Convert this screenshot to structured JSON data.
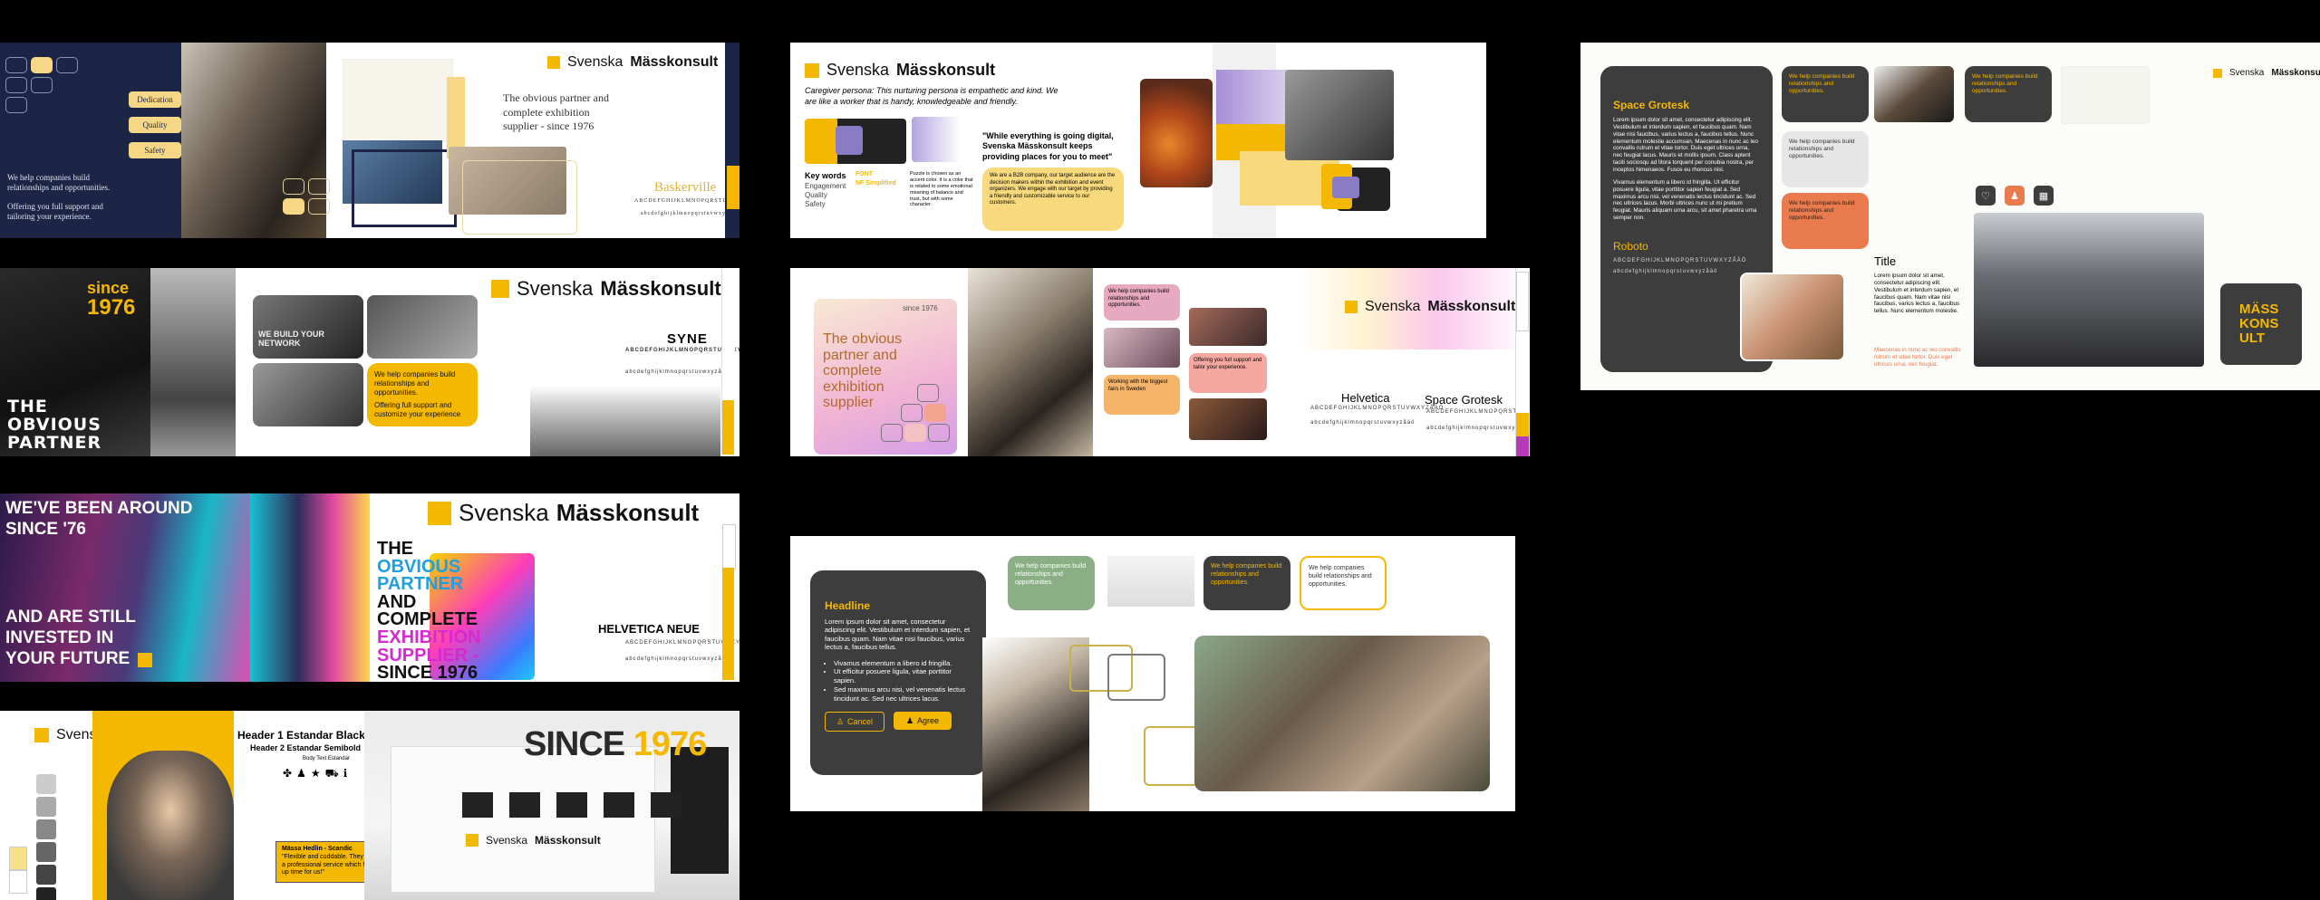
{
  "brand": {
    "name_light": "Svenska",
    "name_bold": "Mässkonsult",
    "accent": "#f5b800"
  },
  "board1": {
    "buttons": [
      "Dedication",
      "Quality",
      "Safety"
    ],
    "blurb": "We help companies build relationships and opportunities.",
    "blurb2": "Offering you full support and tailoring your experience.",
    "tagline": "The obvious partner and complete exhibition supplier - since 1976",
    "font_name": "Baskerville",
    "font_alpha": "ABCDEFGHIJKLMNOPQRSTUVWXYZÅÄÖ",
    "font_alpha_lower": "abcdefghijklmnopqrstuvwxyzåäö"
  },
  "board2": {
    "since": "since",
    "year": "1976",
    "headline": "THE OBVIOUS PARTNER",
    "photo_caption": "WE BUILD YOUR NETWORK",
    "card_text": "We help companies build relationships and opportunities.",
    "card_text2": "Offering full support and customize your experience",
    "font_name": "SYNE",
    "font_alpha": "ABCDEFGHIJKLMNOPQRSTUVWXYZÅÄÖ",
    "font_alpha_lower": "abcdefghijklmnopqrstuvwxyzåäö"
  },
  "board3": {
    "headline1": "WE'VE BEEN AROUND SINCE '76",
    "headline2": "AND ARE STILL INVESTED IN YOUR FUTURE",
    "tag_lines": [
      "THE",
      "OBVIOUS",
      "PARTNER",
      "AND",
      "COMPLETE",
      "EXHIBITION",
      "SUPPLIER -",
      "SINCE 1976"
    ],
    "font_name": "HELVETICA NEUE",
    "font_alpha": "ABCDEFGHIJKLMNOPQRSTUVWXYZÅÄÖ",
    "font_alpha_lower": "abcdefghijklmnopqrstuvwxyzåäö"
  },
  "board4": {
    "header1": "Header 1 Estandar Black",
    "header2": "Header 2 Estandar Semibold",
    "body": "Body Text Estandar",
    "quote_name": "Mässa Hedlin - Scandic",
    "quote": "\"Flexible and cuddable. They have a professional service which frees up time for us!\"",
    "since": "SINCE",
    "year": "1976"
  },
  "board5": {
    "persona": "Caregiver persona: This nurturing persona is empathetic and kind. We are like a worker that is handy, knowledgeable and friendly.",
    "quote": "\"While everything is going digital, Svenska Mässkonsult keeps providing places for you to meet\"",
    "keywords_title": "Key words",
    "keywords": [
      "Engagement",
      "Quality",
      "Safety"
    ],
    "font_label": "FONT",
    "font_value": "NF Simplified",
    "puzzle_text": "Puzzle is chosen as an accent color. It is a color that is related to some emotional meaning of balance and trust, but with some character.",
    "card_text": "We are a B2B company, our target audience are the decision makers within the exhibition and event organizers. We engage with our target by providing a friendly and customizable service to our customers."
  },
  "board6": {
    "since": "since 1976",
    "headline": "The obvious partner and complete exhibition supplier",
    "card1": "We help companies build relationships and opportunities.",
    "card2": "Offering you full support and tailor your experience.",
    "card3": "Working with the biggest fairs in Sweden",
    "font1_name": "Helvetica",
    "font2_name": "Space Grotesk",
    "font_alpha": "ABCDEFGHIJKLMNOPQRSTUVWXYZÅÄÖ",
    "font_alpha_lower": "abcdefghijklmnopqrstuvwxyzåäö"
  },
  "board7": {
    "headline": "Headline",
    "body": "Lorem ipsum dolor sit amet, consectetur adipiscing elit. Vestibulum et interdum sapien, et faucibus quam. Nam vitae nisi faucibus, varius lectus a, faucibus tellus.",
    "bullets": [
      "Vivamus elementum a libero id fringilla.",
      "Ut efficitur posuere ligula, vitae porttitor sapien.",
      "Sed maximus arcu nisi, vel venenatis lectus tincidunt ac. Sed nec ultrices lacus."
    ],
    "cancel": "Cancel",
    "agree": "Agree",
    "card_text": "We help companies build relationships and opportunities."
  },
  "board8": {
    "font1_name": "Space Grotesk",
    "font1_body": "Lorem ipsum dolor sit amet, consectetur adipiscing elit. Vestibulum et interdum sapien, et faucibus quam. Nam vitae nisi faucibus, varius lectus a, faucibus tellus. Nunc elementum molestie accumsan. Maecenas in nunc ac leo convallis rutrum et vitae tortor. Duis eget ultrices urna, nec feugiat lacus. Mauris et mollis ipsum. Class aptent taciti sociosqu ad litora torquent per conubia nostra, per inceptos himenaeos. Fusce eu rhoncus nisl.",
    "font1_body2": "Vivamus elementum a libero id fringilla. Ut efficitur posuere ligula, vitae porttitor sapien feugiat a. Sed maximus arcu nisi, vel venenatis lectus tincidunt ac. Sed nec ultrices lacus. Morbi ultrices nunc ut mi pretium feugiat. Mauris aliquam urna arcu, sit amet pharetra urna semper non.",
    "font2_name": "Roboto",
    "font_alpha": "ABCDEFGHIJKLMNOPQRSTUVWXYZÅÄÖ",
    "font_alpha_lower": "abcdefghijklmnopqrstuvwxyzåäö",
    "card_text": "We help companies build relationships and opportunities.",
    "title": "Title",
    "title_body": "Lorem ipsum dolor sit amet, consectetur adipiscing elit. Vestibulum et interdum sapien, et faucibus quam. Nam vitae nisi faucibus, varius lectus a, faucibus tellus. Nunc elementum molestie.",
    "title_accent": "Maecenas in nunc ac leo convallis rutrum et vitae tortor. Duis eget ultrices urna, nec feugiat.",
    "badge": "MÄSS KONS ULT"
  }
}
